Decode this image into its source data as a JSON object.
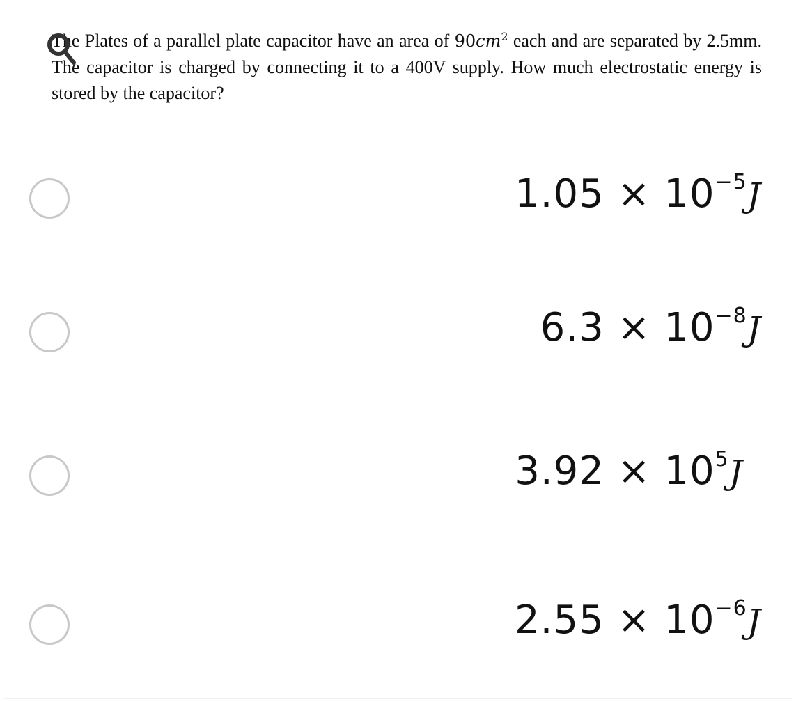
{
  "question": {
    "text_before": "The Plates of a parallel plate capacitor have an area of ",
    "area_value": "90",
    "area_unit": "cm",
    "area_exponent": "2",
    "text_after": " each and are separated by 2.5mm. The capacitor is charged by connecting it to a 400V supply. How much electrostatic energy is stored by the capacitor?"
  },
  "options": [
    {
      "mantissa": "1.05 × 10",
      "exponent": "−5",
      "unit": "J"
    },
    {
      "mantissa": "6.3 × 10",
      "exponent": "−8",
      "unit": "J"
    },
    {
      "mantissa": "3.92 × 10",
      "exponent": "5",
      "unit": "J"
    },
    {
      "mantissa": "2.55 × 10",
      "exponent": "−6",
      "unit": "J"
    }
  ],
  "icons": {
    "overlay": "search-icon",
    "option": "radio-button"
  }
}
